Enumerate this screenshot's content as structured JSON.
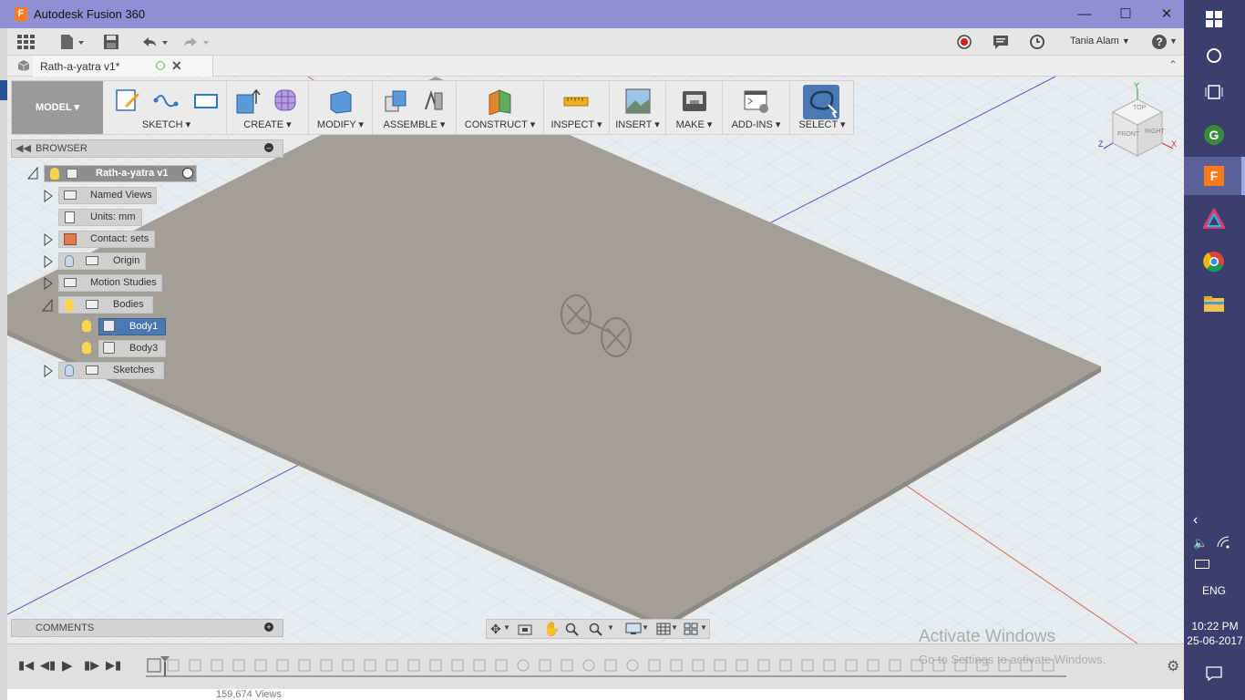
{
  "window": {
    "title": "Autodesk Fusion 360",
    "app_icon_letter": "F"
  },
  "qat": {
    "user": "Tania Alam",
    "help": "?"
  },
  "document": {
    "tab_title": "Rath-a-yatra v1*"
  },
  "toolbar": {
    "workspace": "MODEL",
    "groups": [
      "SKETCH",
      "CREATE",
      "MODIFY",
      "ASSEMBLE",
      "CONSTRUCT",
      "INSPECT",
      "INSERT",
      "MAKE",
      "ADD-INS",
      "SELECT"
    ]
  },
  "browser": {
    "header": "BROWSER",
    "root": "Rath-a-yatra v1",
    "items": [
      {
        "label": "Named Views"
      },
      {
        "label": "Units: mm"
      },
      {
        "label": "Contact: sets"
      },
      {
        "label": "Origin"
      },
      {
        "label": "Motion Studies"
      },
      {
        "label": "Bodies"
      },
      {
        "label": "Body1"
      },
      {
        "label": "Body3"
      },
      {
        "label": "Sketches"
      }
    ]
  },
  "viewcube": {
    "top": "TOP",
    "front": "FRONT",
    "right": "RIGHT",
    "x": "X",
    "y": "Y",
    "z": "Z"
  },
  "comments": {
    "header": "COMMENTS"
  },
  "watermark": {
    "line1": "Activate Windows",
    "line2": "Go to Settings to activate Windows."
  },
  "behind_page": {
    "views": "159,674 Views"
  },
  "taskbar": {
    "time": "10:22 PM",
    "date": "25-06-2017",
    "lang": "ENG"
  },
  "colors": {
    "titlebar": "#8f8fd6",
    "plane": "#a19f96",
    "taskbar": "#3a3f6e",
    "selected": "#4a78b5"
  }
}
